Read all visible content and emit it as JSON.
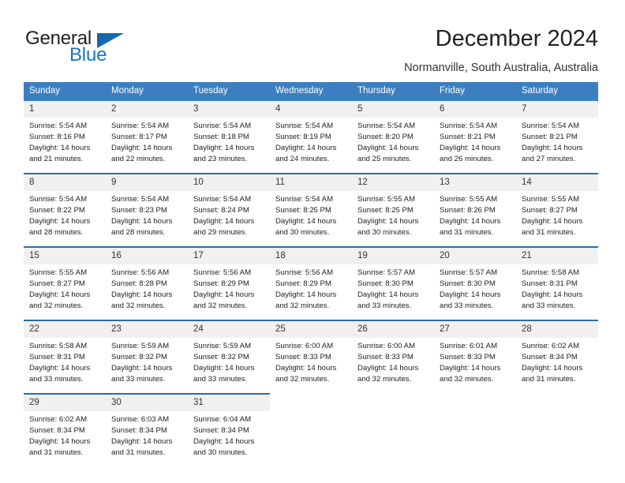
{
  "logo": {
    "word1": "General",
    "word2": "Blue",
    "triangle_color": "#1667ae",
    "blue_color": "#1c72c4"
  },
  "header": {
    "title": "December 2024",
    "subtitle": "Normanville, South Australia, Australia"
  },
  "theme": {
    "header_bg": "#3c7fc1",
    "week_rule": "#2e6da4",
    "daynum_bg": "#f0f0f0",
    "text": "#222222"
  },
  "calendar": {
    "weekday_headers": [
      "Sunday",
      "Monday",
      "Tuesday",
      "Wednesday",
      "Thursday",
      "Friday",
      "Saturday"
    ],
    "weeks": [
      [
        {
          "day": "1",
          "sunrise": "Sunrise: 5:54 AM",
          "sunset": "Sunset: 8:16 PM",
          "daylight1": "Daylight: 14 hours",
          "daylight2": "and 21 minutes."
        },
        {
          "day": "2",
          "sunrise": "Sunrise: 5:54 AM",
          "sunset": "Sunset: 8:17 PM",
          "daylight1": "Daylight: 14 hours",
          "daylight2": "and 22 minutes."
        },
        {
          "day": "3",
          "sunrise": "Sunrise: 5:54 AM",
          "sunset": "Sunset: 8:18 PM",
          "daylight1": "Daylight: 14 hours",
          "daylight2": "and 23 minutes."
        },
        {
          "day": "4",
          "sunrise": "Sunrise: 5:54 AM",
          "sunset": "Sunset: 8:19 PM",
          "daylight1": "Daylight: 14 hours",
          "daylight2": "and 24 minutes."
        },
        {
          "day": "5",
          "sunrise": "Sunrise: 5:54 AM",
          "sunset": "Sunset: 8:20 PM",
          "daylight1": "Daylight: 14 hours",
          "daylight2": "and 25 minutes."
        },
        {
          "day": "6",
          "sunrise": "Sunrise: 5:54 AM",
          "sunset": "Sunset: 8:21 PM",
          "daylight1": "Daylight: 14 hours",
          "daylight2": "and 26 minutes."
        },
        {
          "day": "7",
          "sunrise": "Sunrise: 5:54 AM",
          "sunset": "Sunset: 8:21 PM",
          "daylight1": "Daylight: 14 hours",
          "daylight2": "and 27 minutes."
        }
      ],
      [
        {
          "day": "8",
          "sunrise": "Sunrise: 5:54 AM",
          "sunset": "Sunset: 8:22 PM",
          "daylight1": "Daylight: 14 hours",
          "daylight2": "and 28 minutes."
        },
        {
          "day": "9",
          "sunrise": "Sunrise: 5:54 AM",
          "sunset": "Sunset: 8:23 PM",
          "daylight1": "Daylight: 14 hours",
          "daylight2": "and 28 minutes."
        },
        {
          "day": "10",
          "sunrise": "Sunrise: 5:54 AM",
          "sunset": "Sunset: 8:24 PM",
          "daylight1": "Daylight: 14 hours",
          "daylight2": "and 29 minutes."
        },
        {
          "day": "11",
          "sunrise": "Sunrise: 5:54 AM",
          "sunset": "Sunset: 8:25 PM",
          "daylight1": "Daylight: 14 hours",
          "daylight2": "and 30 minutes."
        },
        {
          "day": "12",
          "sunrise": "Sunrise: 5:55 AM",
          "sunset": "Sunset: 8:25 PM",
          "daylight1": "Daylight: 14 hours",
          "daylight2": "and 30 minutes."
        },
        {
          "day": "13",
          "sunrise": "Sunrise: 5:55 AM",
          "sunset": "Sunset: 8:26 PM",
          "daylight1": "Daylight: 14 hours",
          "daylight2": "and 31 minutes."
        },
        {
          "day": "14",
          "sunrise": "Sunrise: 5:55 AM",
          "sunset": "Sunset: 8:27 PM",
          "daylight1": "Daylight: 14 hours",
          "daylight2": "and 31 minutes."
        }
      ],
      [
        {
          "day": "15",
          "sunrise": "Sunrise: 5:55 AM",
          "sunset": "Sunset: 8:27 PM",
          "daylight1": "Daylight: 14 hours",
          "daylight2": "and 32 minutes."
        },
        {
          "day": "16",
          "sunrise": "Sunrise: 5:56 AM",
          "sunset": "Sunset: 8:28 PM",
          "daylight1": "Daylight: 14 hours",
          "daylight2": "and 32 minutes."
        },
        {
          "day": "17",
          "sunrise": "Sunrise: 5:56 AM",
          "sunset": "Sunset: 8:29 PM",
          "daylight1": "Daylight: 14 hours",
          "daylight2": "and 32 minutes."
        },
        {
          "day": "18",
          "sunrise": "Sunrise: 5:56 AM",
          "sunset": "Sunset: 8:29 PM",
          "daylight1": "Daylight: 14 hours",
          "daylight2": "and 32 minutes."
        },
        {
          "day": "19",
          "sunrise": "Sunrise: 5:57 AM",
          "sunset": "Sunset: 8:30 PM",
          "daylight1": "Daylight: 14 hours",
          "daylight2": "and 33 minutes."
        },
        {
          "day": "20",
          "sunrise": "Sunrise: 5:57 AM",
          "sunset": "Sunset: 8:30 PM",
          "daylight1": "Daylight: 14 hours",
          "daylight2": "and 33 minutes."
        },
        {
          "day": "21",
          "sunrise": "Sunrise: 5:58 AM",
          "sunset": "Sunset: 8:31 PM",
          "daylight1": "Daylight: 14 hours",
          "daylight2": "and 33 minutes."
        }
      ],
      [
        {
          "day": "22",
          "sunrise": "Sunrise: 5:58 AM",
          "sunset": "Sunset: 8:31 PM",
          "daylight1": "Daylight: 14 hours",
          "daylight2": "and 33 minutes."
        },
        {
          "day": "23",
          "sunrise": "Sunrise: 5:59 AM",
          "sunset": "Sunset: 8:32 PM",
          "daylight1": "Daylight: 14 hours",
          "daylight2": "and 33 minutes."
        },
        {
          "day": "24",
          "sunrise": "Sunrise: 5:59 AM",
          "sunset": "Sunset: 8:32 PM",
          "daylight1": "Daylight: 14 hours",
          "daylight2": "and 33 minutes."
        },
        {
          "day": "25",
          "sunrise": "Sunrise: 6:00 AM",
          "sunset": "Sunset: 8:33 PM",
          "daylight1": "Daylight: 14 hours",
          "daylight2": "and 32 minutes."
        },
        {
          "day": "26",
          "sunrise": "Sunrise: 6:00 AM",
          "sunset": "Sunset: 8:33 PM",
          "daylight1": "Daylight: 14 hours",
          "daylight2": "and 32 minutes."
        },
        {
          "day": "27",
          "sunrise": "Sunrise: 6:01 AM",
          "sunset": "Sunset: 8:33 PM",
          "daylight1": "Daylight: 14 hours",
          "daylight2": "and 32 minutes."
        },
        {
          "day": "28",
          "sunrise": "Sunrise: 6:02 AM",
          "sunset": "Sunset: 8:34 PM",
          "daylight1": "Daylight: 14 hours",
          "daylight2": "and 31 minutes."
        }
      ],
      [
        {
          "day": "29",
          "sunrise": "Sunrise: 6:02 AM",
          "sunset": "Sunset: 8:34 PM",
          "daylight1": "Daylight: 14 hours",
          "daylight2": "and 31 minutes."
        },
        {
          "day": "30",
          "sunrise": "Sunrise: 6:03 AM",
          "sunset": "Sunset: 8:34 PM",
          "daylight1": "Daylight: 14 hours",
          "daylight2": "and 31 minutes."
        },
        {
          "day": "31",
          "sunrise": "Sunrise: 6:04 AM",
          "sunset": "Sunset: 8:34 PM",
          "daylight1": "Daylight: 14 hours",
          "daylight2": "and 30 minutes."
        },
        null,
        null,
        null,
        null
      ]
    ]
  }
}
